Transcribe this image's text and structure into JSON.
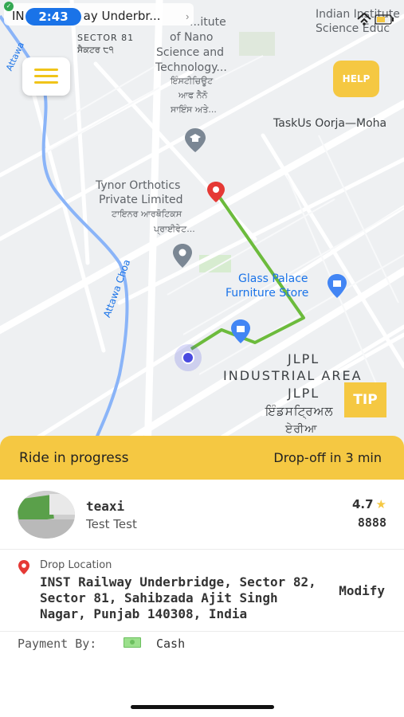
{
  "status_bar": {
    "time": "2:43",
    "banner_prefix": "IN",
    "banner_text": "ay Underbr..."
  },
  "map": {
    "labels": {
      "sector81": "SECTOR 81",
      "sector81_punjabi": "ਸੈਕਟਰ ੮੧",
      "nano_institute": [
        "...itute",
        "of Nano",
        "Science and",
        "Technology...",
        "ਇੰਸਟੀਚਿਊਟ",
        "ਆਫ ਨੈਨੋ",
        "ਸਾਇੰਸ ਅਤੇ..."
      ],
      "indian_institute": [
        "Indian Institute",
        "Science Educ"
      ],
      "taskus": "TaskUs Oorja—Moha",
      "tynor": [
        "Tynor Orthotics",
        "Private Limited",
        "ਟਾਇਨਰ ਆਰਥੋਟਿਕਸ",
        "ਪ੍ਰਾਈਵੇਟ..."
      ],
      "attawa_top": "Attawa",
      "attawa_choa": "Attawa Choa",
      "glass_palace": [
        "Glass Palace",
        "Furniture Store"
      ],
      "jlpl": [
        "JLPL",
        "INDUSTRIAL AREA",
        "JLPL",
        "ਇੰਡਸਟ੍ਰਿਅਲ",
        "ਏਰੀਆ"
      ]
    },
    "route_color": "#6cbb3c",
    "menu_icon": "hamburger-icon",
    "help_label": "HELP",
    "tip_label": "TIP"
  },
  "ride": {
    "status": "Ride in progress",
    "eta": "Drop-off in 3 min"
  },
  "driver": {
    "name": "teaxi",
    "subtitle": "Test Test",
    "rating": "4.7",
    "vehicle_number": "8888"
  },
  "drop": {
    "label": "Drop Location",
    "address": "INST Railway Underbridge, Sector 82, Sector 81, Sahibzada Ajit Singh Nagar, Punjab 140308, India",
    "modify_label": "Modify"
  },
  "payment": {
    "label": "Payment By:",
    "method": "Cash"
  },
  "colors": {
    "accent": "#f5c842",
    "route": "#6cbb3c",
    "location_dot": "#4a4ae0",
    "pin_red": "#e53935",
    "status_blue": "#1a73e8"
  }
}
